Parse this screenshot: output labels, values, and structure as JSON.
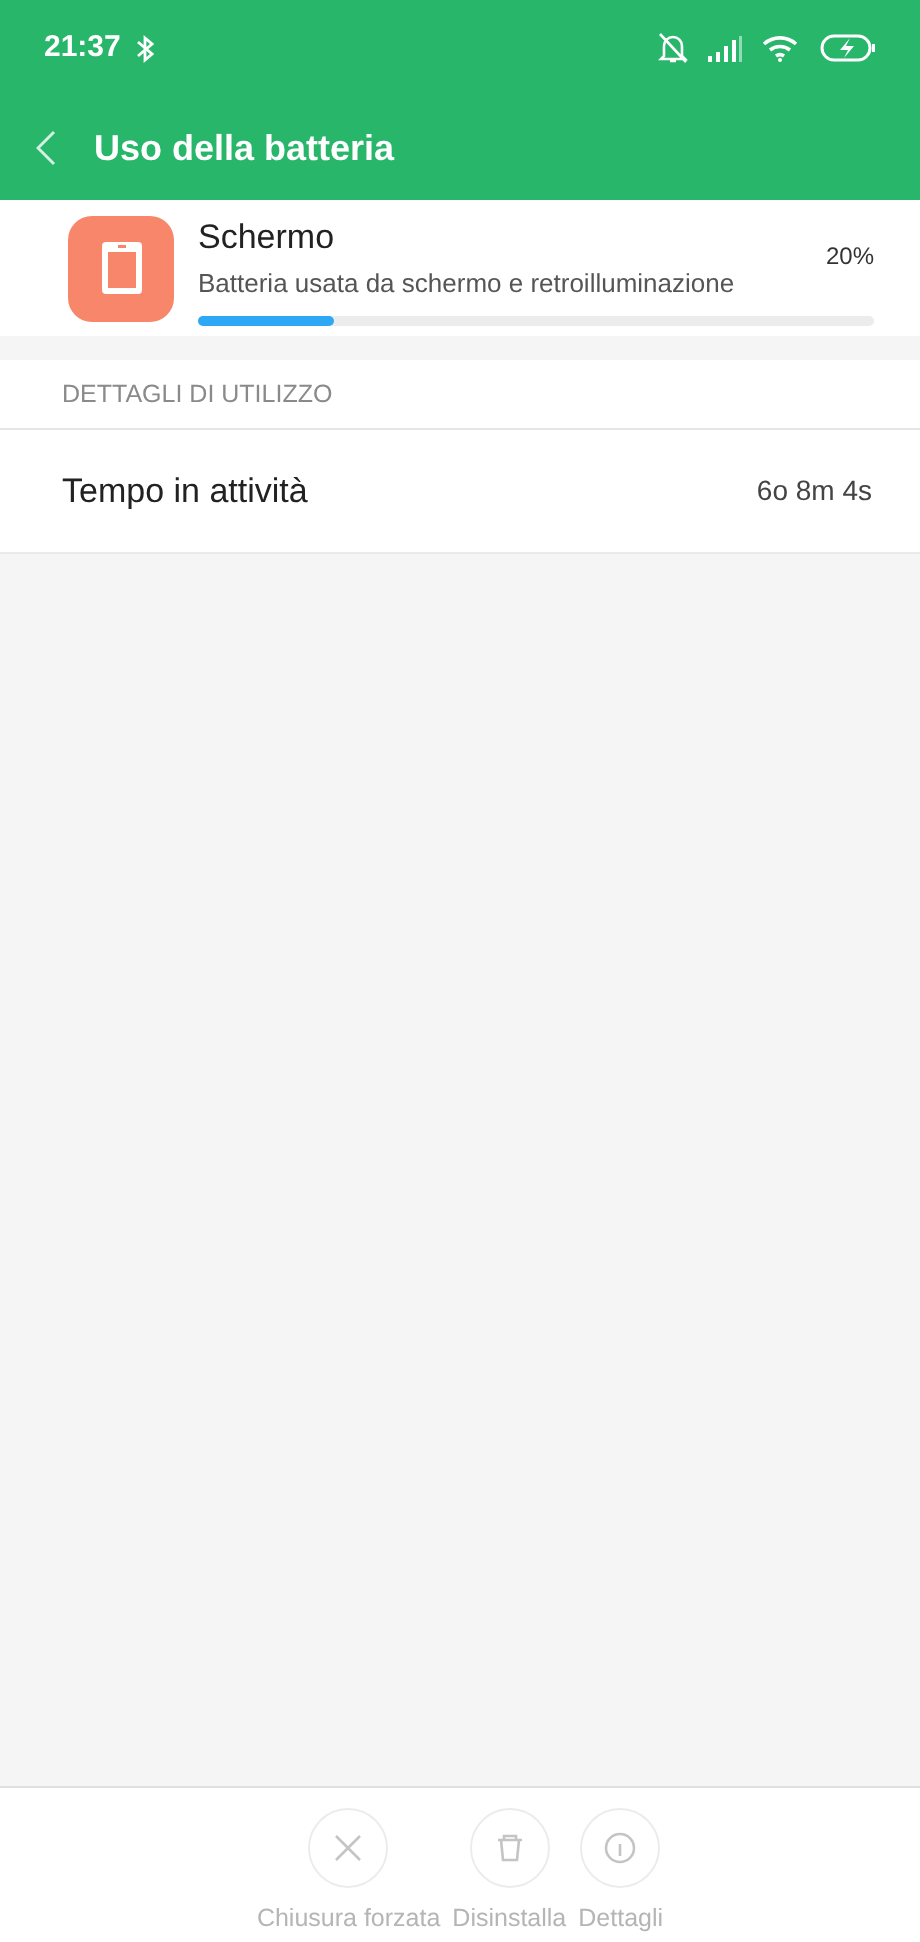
{
  "status_bar": {
    "time": "21:37"
  },
  "header": {
    "title": "Uso della batteria"
  },
  "app": {
    "name": "Schermo",
    "description": "Batteria usata da schermo e retroilluminazione",
    "percent": "20%",
    "level": 0.2
  },
  "section": {
    "title": "DETTAGLI DI UTILIZZO",
    "rows": [
      {
        "label": "Tempo in attività",
        "value": "6o 8m 4s"
      }
    ]
  },
  "actions": [
    {
      "kind": "close",
      "label": "Chiusura forzata",
      "disabled": true
    },
    {
      "kind": "delete",
      "label": "Disinstalla",
      "disabled": true
    },
    {
      "kind": "info",
      "label": "Dettagli",
      "disabled": true
    }
  ]
}
